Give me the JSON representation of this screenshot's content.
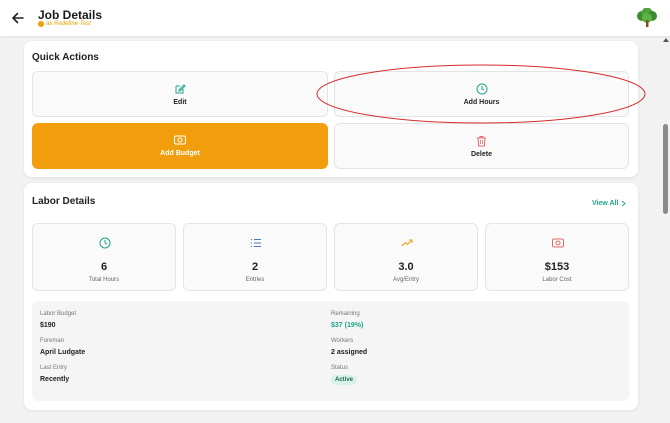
{
  "header": {
    "title": "Job Details",
    "subtitle": "as Redefine Test",
    "back_icon": "arrow-left-icon",
    "logo_icon": "tree-logo-icon"
  },
  "quick_actions": {
    "title": "Quick Actions",
    "edit_label": "Edit",
    "add_hours_label": "Add Hours",
    "add_budget_label": "Add Budget",
    "delete_label": "Delete"
  },
  "labor": {
    "title": "Labor Details",
    "view_all": "View All",
    "stats": [
      {
        "value": "6",
        "caption": "Total Hours",
        "icon": "clock-icon"
      },
      {
        "value": "2",
        "caption": "Entries",
        "icon": "list-icon"
      },
      {
        "value": "3.0",
        "caption": "Avg/Entry",
        "icon": "trend-up-icon"
      },
      {
        "value": "$153",
        "caption": "Labor Cost",
        "icon": "money-icon"
      }
    ],
    "details": {
      "labor_budget_label": "Labor Budget",
      "labor_budget_value": "$190",
      "remaining_label": "Remaining",
      "remaining_value": "$37 (19%)",
      "foreman_label": "Foreman",
      "foreman_value": "April Ludgate",
      "workers_label": "Workers",
      "workers_value": "2 assigned",
      "last_entry_label": "Last Entry",
      "last_entry_value": "Recently",
      "status_label": "Status",
      "status_value": "Active"
    }
  },
  "colors": {
    "accent_green": "#20a58a",
    "brand_orange": "#f29e0c",
    "delete_red": "#e46a6a",
    "highlight_red": "#d42b2b"
  }
}
